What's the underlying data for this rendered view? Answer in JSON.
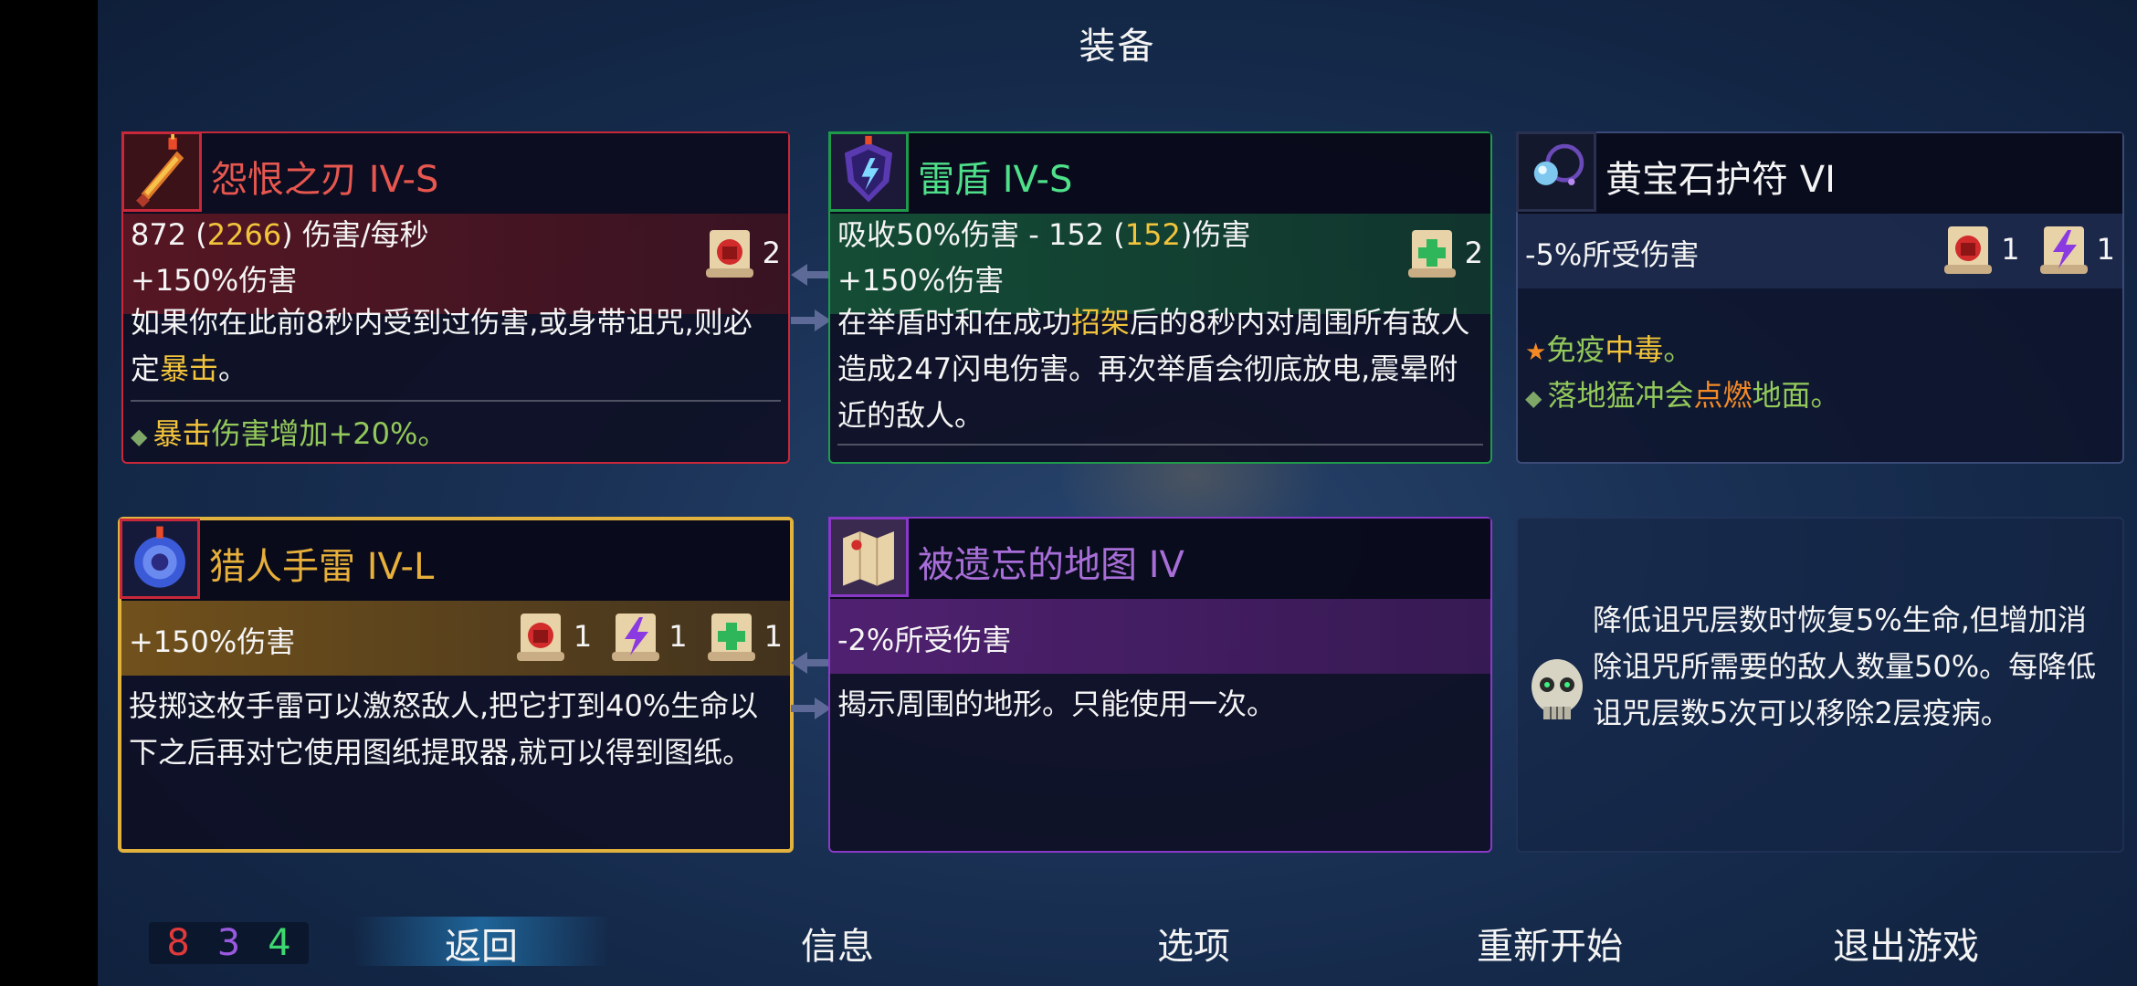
{
  "title": "装备",
  "colors": {
    "red_border": "#c8283a",
    "green_border": "#1f9a4b",
    "purple_border": "#8a38c8",
    "gold_border": "#e2b23e",
    "yellow_text": "#f2c43b",
    "orange_text": "#f38a26",
    "green_text": "#93c95a",
    "red_name": "#e8574f",
    "green_name": "#4fe08a",
    "gold_name": "#e8b03a",
    "purple_name": "#a86ed8"
  },
  "cards": {
    "weapon1": {
      "name": "怨恨之刃 IV-S",
      "stat_a": "872",
      "stat_b": "2266",
      "stat_c": "伤害/每秒",
      "bonus": "+150%伤害",
      "scroll_brutality": "2",
      "desc_a": "如果你在此前8秒内受到过伤害,或身带诅咒,则必定",
      "desc_keyword": "暴击",
      "desc_b": "。",
      "affix_keyword": "暴击",
      "affix_rest": "伤害增加+20%。",
      "icon": "sword-icon"
    },
    "weapon2": {
      "name": "雷盾 IV-S",
      "stat_a": "吸收50%伤害 - 152 (",
      "stat_b": "152",
      "stat_c": ")伤害",
      "bonus": "+150%伤害",
      "scroll_survival": "2",
      "desc_a": "在举盾时和在成功",
      "desc_keyword": "招架",
      "desc_b": "后的8秒内对周围所有敌人造成247闪电伤害。再次举盾会彻底放电,震晕附近的敌人。",
      "icon": "shield-icon"
    },
    "amulet": {
      "name": "黄宝石护符 VI",
      "stat": "-5%所受伤害",
      "scroll_brutality": "1",
      "scroll_tactics": "1",
      "affix1_a": "免疫",
      "affix1_keyword": "中毒",
      "affix1_b": "。",
      "affix2_a": "落地猛冲会",
      "affix2_keyword": "点燃",
      "affix2_b": "地面。",
      "icon": "amulet-icon"
    },
    "skill1": {
      "name": "猎人手雷 IV-L",
      "bonus": "+150%伤害",
      "scroll_brutality": "1",
      "scroll_tactics": "1",
      "scroll_survival": "1",
      "desc": "投掷这枚手雷可以激怒敌人,把它打到40%生命以下之后再对它使用图纸提取器,就可以得到图纸。",
      "icon": "grenade-icon"
    },
    "skill2": {
      "name": "被遗忘的地图 IV",
      "stat": "-2%所受伤害",
      "desc": "揭示周围的地形。只能使用一次。",
      "icon": "map-icon"
    },
    "curse": {
      "desc": "降低诅咒层数时恢复5%生命,但增加消除诅咒所需要的敌人数量50%。每降低诅咒层数5次可以移除2层疫病。",
      "icon": "skull-icon"
    }
  },
  "counters": {
    "red": "8",
    "purple": "3",
    "green": "4"
  },
  "nav": {
    "back": "返回",
    "info": "信息",
    "options": "选项",
    "restart": "重新开始",
    "quit": "退出游戏"
  }
}
